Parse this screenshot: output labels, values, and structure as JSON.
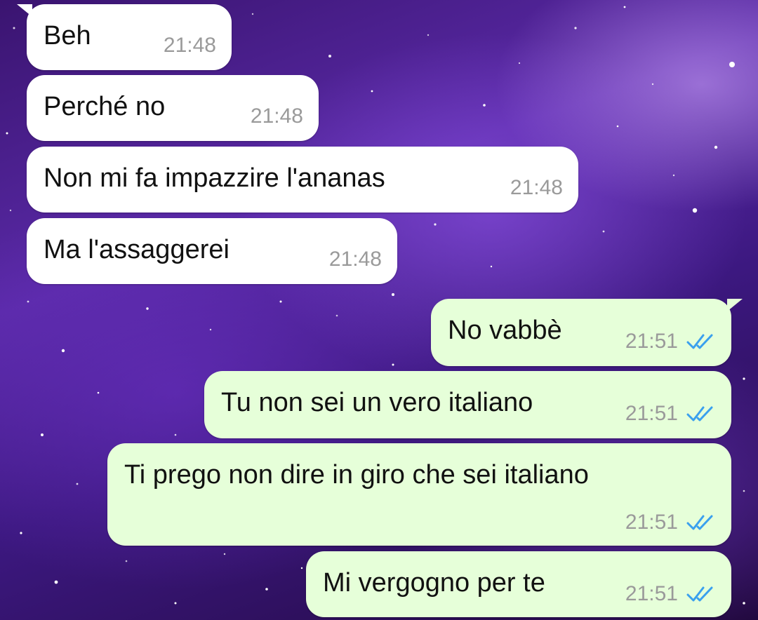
{
  "chat": {
    "messages": [
      {
        "direction": "incoming",
        "text": "Beh",
        "time": "21:48"
      },
      {
        "direction": "incoming",
        "text": "Perché no",
        "time": "21:48"
      },
      {
        "direction": "incoming",
        "text": "Non mi fa impazzire l'ananas",
        "time": "21:48"
      },
      {
        "direction": "incoming",
        "text": "Ma l'assaggerei",
        "time": "21:48"
      },
      {
        "direction": "outgoing",
        "text": "No vabbè",
        "time": "21:51",
        "status": "read",
        "status_icon": "double-check-icon"
      },
      {
        "direction": "outgoing",
        "text": "Tu non sei un vero italiano",
        "time": "21:51",
        "status": "read",
        "status_icon": "double-check-icon"
      },
      {
        "direction": "outgoing",
        "text": "Ti prego non dire in giro che sei italiano",
        "time": "21:51",
        "status": "read",
        "status_icon": "double-check-icon"
      },
      {
        "direction": "outgoing",
        "text": "Mi vergogno per te",
        "time": "21:51",
        "status": "read",
        "status_icon": "double-check-icon"
      }
    ]
  },
  "theme": {
    "incoming_bubble": "#ffffff",
    "outgoing_bubble": "#e6ffd9",
    "read_tick_color": "#3aa0ee",
    "wallpaper": "purple galaxy"
  }
}
